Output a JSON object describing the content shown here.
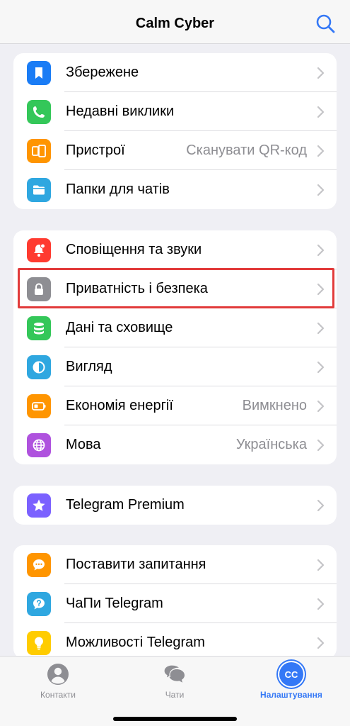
{
  "header": {
    "title": "Calm Cyber"
  },
  "groups": [
    {
      "items": [
        {
          "label": "Збережене",
          "value": "",
          "icon": "bookmark-icon",
          "color": "#1a7cf5"
        },
        {
          "label": "Недавні виклики",
          "value": "",
          "icon": "phone-icon",
          "color": "#34c759"
        },
        {
          "label": "Пристрої",
          "value": "Сканувати QR-код",
          "icon": "devices-icon",
          "color": "#ff9500"
        },
        {
          "label": "Папки для чатів",
          "value": "",
          "icon": "folder-icon",
          "color": "#2fa7e0"
        }
      ]
    },
    {
      "items": [
        {
          "label": "Сповіщення та звуки",
          "value": "",
          "icon": "bell-icon",
          "color": "#ff3b30"
        },
        {
          "label": "Приватність і безпека",
          "value": "",
          "icon": "lock-icon",
          "color": "#8e8e93"
        },
        {
          "label": "Дані та сховище",
          "value": "",
          "icon": "database-icon",
          "color": "#34c759"
        },
        {
          "label": "Вигляд",
          "value": "",
          "icon": "appearance-icon",
          "color": "#2fa7e0"
        },
        {
          "label": "Економія енергії",
          "value": "Вимкнено",
          "icon": "battery-icon",
          "color": "#ff9500"
        },
        {
          "label": "Мова",
          "value": "Українська",
          "icon": "globe-icon",
          "color": "#af52de"
        }
      ]
    },
    {
      "items": [
        {
          "label": "Telegram Premium",
          "value": "",
          "icon": "star-icon",
          "color": "#7b61ff"
        }
      ]
    },
    {
      "items": [
        {
          "label": "Поставити запитання",
          "value": "",
          "icon": "chat-dots-icon",
          "color": "#ff9500"
        },
        {
          "label": "ЧаПи Telegram",
          "value": "",
          "icon": "question-icon",
          "color": "#2fa7e0"
        },
        {
          "label": "Можливості Telegram",
          "value": "",
          "icon": "lightbulb-icon",
          "color": "#ffcc00"
        }
      ]
    }
  ],
  "tabbar": {
    "contacts": "Контакти",
    "chats": "Чати",
    "settings": "Налаштування",
    "avatar_initials": "CC",
    "active_color": "#3478f6"
  }
}
